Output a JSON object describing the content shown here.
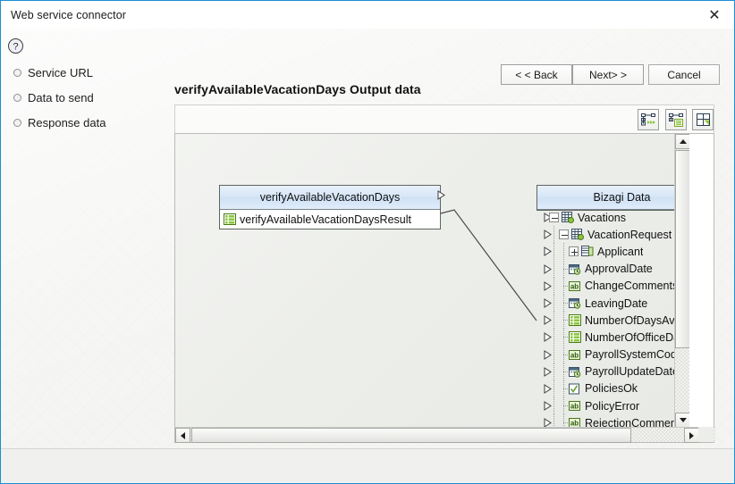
{
  "window": {
    "title": "Web service connector",
    "close_icon": "close-icon"
  },
  "sidebar": {
    "items": [
      {
        "label": "Service URL",
        "icon": "radio-bullet-icon"
      },
      {
        "label": "Data to send",
        "icon": "radio-bullet-icon"
      },
      {
        "label": "Response data",
        "icon": "radio-bullet-icon"
      }
    ]
  },
  "main": {
    "title": "verifyAvailableVacationDays Output data",
    "toolbar": [
      {
        "name": "auto-map-all-icon",
        "tip": "Auto map all"
      },
      {
        "name": "auto-map-selected-icon",
        "tip": "Auto map selected"
      },
      {
        "name": "fit-to-window-icon",
        "tip": "Fit to window"
      }
    ],
    "source_node": {
      "header": "verifyAvailableVacationDays",
      "rows": [
        {
          "label": "verifyAvailableVacationDaysResult",
          "icon": "collection-icon",
          "port": "output-port"
        }
      ]
    },
    "target_node": {
      "header": "Bizagi Data",
      "rows": [
        {
          "label": "Vacations",
          "indent": 0,
          "expander": "minus",
          "icon": "entity-icon",
          "port": "input-port"
        },
        {
          "label": "VacationRequest",
          "indent": 1,
          "expander": "minus",
          "icon": "entity-icon",
          "port": "input-port"
        },
        {
          "label": "Applicant",
          "indent": 2,
          "expander": "plus",
          "icon": "relation-icon",
          "port": "input-port"
        },
        {
          "label": "ApprovalDate",
          "indent": 2,
          "expander": "none",
          "icon": "date-icon",
          "port": "input-port"
        },
        {
          "label": "ChangeComments",
          "indent": 2,
          "expander": "none",
          "icon": "text-icon",
          "port": "input-port"
        },
        {
          "label": "LeavingDate",
          "indent": 2,
          "expander": "none",
          "icon": "date-icon",
          "port": "input-port"
        },
        {
          "label": "NumberOfDaysAvailable",
          "indent": 2,
          "expander": "none",
          "icon": "collection-icon",
          "port": "input-port"
        },
        {
          "label": "NumberOfOfficeDays",
          "indent": 2,
          "expander": "none",
          "icon": "collection-icon",
          "port": "input-port"
        },
        {
          "label": "PayrollSystemCode",
          "indent": 2,
          "expander": "none",
          "icon": "text-icon",
          "port": "input-port"
        },
        {
          "label": "PayrollUpdateDate",
          "indent": 2,
          "expander": "none",
          "icon": "date-icon",
          "port": "input-port"
        },
        {
          "label": "PoliciesOk",
          "indent": 2,
          "expander": "none",
          "icon": "boolean-icon",
          "port": "input-port"
        },
        {
          "label": "PolicyError",
          "indent": 2,
          "expander": "none",
          "icon": "text-icon",
          "port": "input-port"
        },
        {
          "label": "RejectionComments",
          "indent": 2,
          "expander": "none",
          "icon": "text-icon",
          "port": "input-port"
        }
      ]
    },
    "mapping": {
      "from": "verifyAvailableVacationDaysResult",
      "to": "NumberOfDaysAvailable"
    },
    "scrollbars": {
      "vertical": {
        "up": "scroll-up-icon",
        "down": "scroll-down-icon"
      },
      "horizontal": {
        "left": "scroll-left-icon",
        "right": "scroll-right-icon"
      }
    }
  },
  "footer": {
    "help_icon": "help-icon",
    "buttons": [
      {
        "label": "< < Back",
        "name": "back-button"
      },
      {
        "label": "Next> >",
        "name": "next-button"
      },
      {
        "label": "Cancel",
        "name": "cancel-button"
      }
    ]
  },
  "colors": {
    "accent": "#1a8fd4",
    "node_header": "#d6e6f7",
    "icon_green": "#8cc63f",
    "body_bg": "#f4f5f2"
  }
}
